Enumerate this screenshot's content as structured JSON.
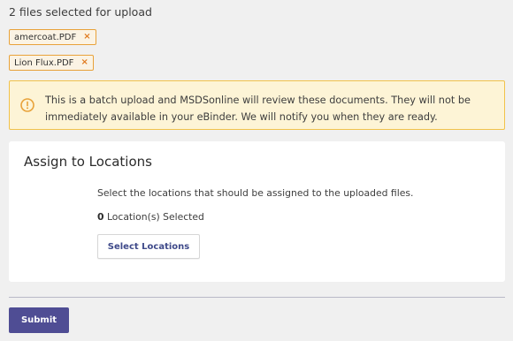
{
  "upload": {
    "files_selected_text": "2 files selected for upload",
    "files": [
      {
        "name": "amercoat.PDF",
        "remove_glyph": "×"
      },
      {
        "name": "Lion Flux.PDF",
        "remove_glyph": "×"
      }
    ]
  },
  "alert": {
    "icon": "warning-circle-icon",
    "text": "This is a batch upload and MSDSonline will review these documents. They will not be immediately available in your eBinder. We will notify you when they are ready."
  },
  "assign": {
    "title": "Assign to Locations",
    "description": "Select the locations that should be assigned to the uploaded files.",
    "selected_count": "0",
    "selected_suffix": " Location(s) Selected",
    "select_button_label": "Select Locations"
  },
  "submit_label": "Submit",
  "colors": {
    "accent": "#4f4d94",
    "chip_border": "#e8a23a",
    "alert_border": "#f1c24a",
    "alert_bg": "#fdf4d6"
  }
}
